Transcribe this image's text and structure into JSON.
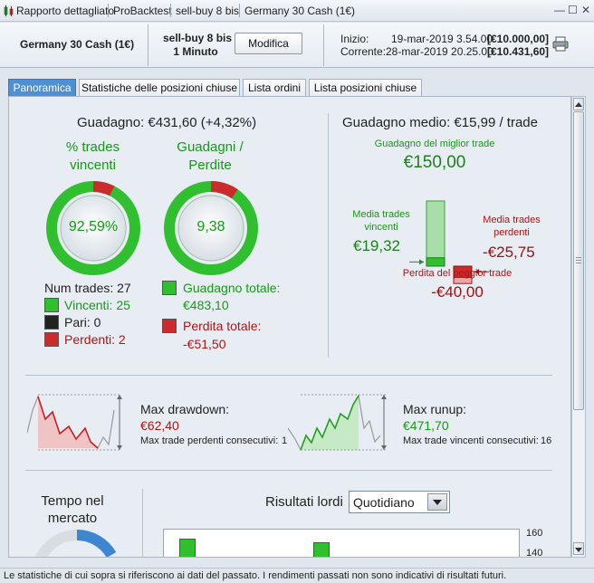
{
  "titlebar": {
    "items": [
      "Rapporto dettagliato",
      "ProBacktest",
      "sell-buy 8 bis",
      "Germany 30 Cash (1€)"
    ]
  },
  "header": {
    "instrument": "Germany 30 Cash (1€)",
    "strategy_name": "sell-buy 8 bis",
    "timeframe": "1 Minuto",
    "modify_label": "Modifica",
    "start_label": "Inizio:",
    "start_date": "19-mar-2019 3.54.00",
    "start_value": "[€10.000,00]",
    "current_label": "Corrente:",
    "current_date": "28-mar-2019 20.25.00",
    "current_value": "[€10.431,60]"
  },
  "tabs": [
    "Panoramica",
    "Statistiche delle posizioni chiuse",
    "Lista ordini",
    "Lista posizioni chiuse"
  ],
  "overview": {
    "gain_title": "Guadagno: €431,60 (+4,32%)",
    "win_pct_title_1": "% trades",
    "win_pct_title_2": "vincenti",
    "win_pct_value": "92,59%",
    "win_pct_fraction": 0.9259,
    "ratio_title_1": "Guadagni /",
    "ratio_title_2": "Perdite",
    "ratio_value": "9,38",
    "ratio_fraction": 0.9034,
    "num_trades": "Num trades: 27",
    "winners": "Vincenti: 25",
    "even": "Pari: 0",
    "losers": "Perdenti: 2",
    "total_gain_label": "Guadagno totale:",
    "total_gain_value": "€483,10",
    "total_loss_label": "Perdita totale:",
    "total_loss_value": "-€51,50"
  },
  "average": {
    "title": "Guadagno medio: €15,99 / trade",
    "best_label": "Guadagno del miglior trade",
    "best_value": "€150,00",
    "avg_win_label_1": "Media trades",
    "avg_win_label_2": "vincenti",
    "avg_win_value": "€19,32",
    "avg_loss_label_1": "Media trades",
    "avg_loss_label_2": "perdenti",
    "avg_loss_value": "-€25,75",
    "worst_label": "Perdita del peggior trade",
    "worst_value": "-€40,00",
    "best": 150,
    "avg_win": 19.32,
    "avg_loss": -25.75,
    "worst": -40
  },
  "drawdown": {
    "title": "Max drawdown:",
    "value": "€62,40",
    "consec_label": "Max trade perdenti consecutivi:",
    "consec_value": "1"
  },
  "runup": {
    "title": "Max runup:",
    "value": "€471,70",
    "consec_label": "Max trade vincenti consecutivi:",
    "consec_value": "16"
  },
  "market_time": {
    "title_1": "Tempo nel",
    "title_2": "mercato"
  },
  "results": {
    "title": "Risultati lordi",
    "period_selected": "Quotidiano",
    "ticks": [
      "160",
      "140"
    ]
  },
  "colors": {
    "green": "#2fbf2f",
    "red": "#cc2b2b",
    "accent": "#4f8fd6"
  },
  "status": {
    "text": "Le statistiche di cui sopra si riferiscono ai dati del passato. I rendimenti passati non sono indicativi di risultati futuri."
  }
}
